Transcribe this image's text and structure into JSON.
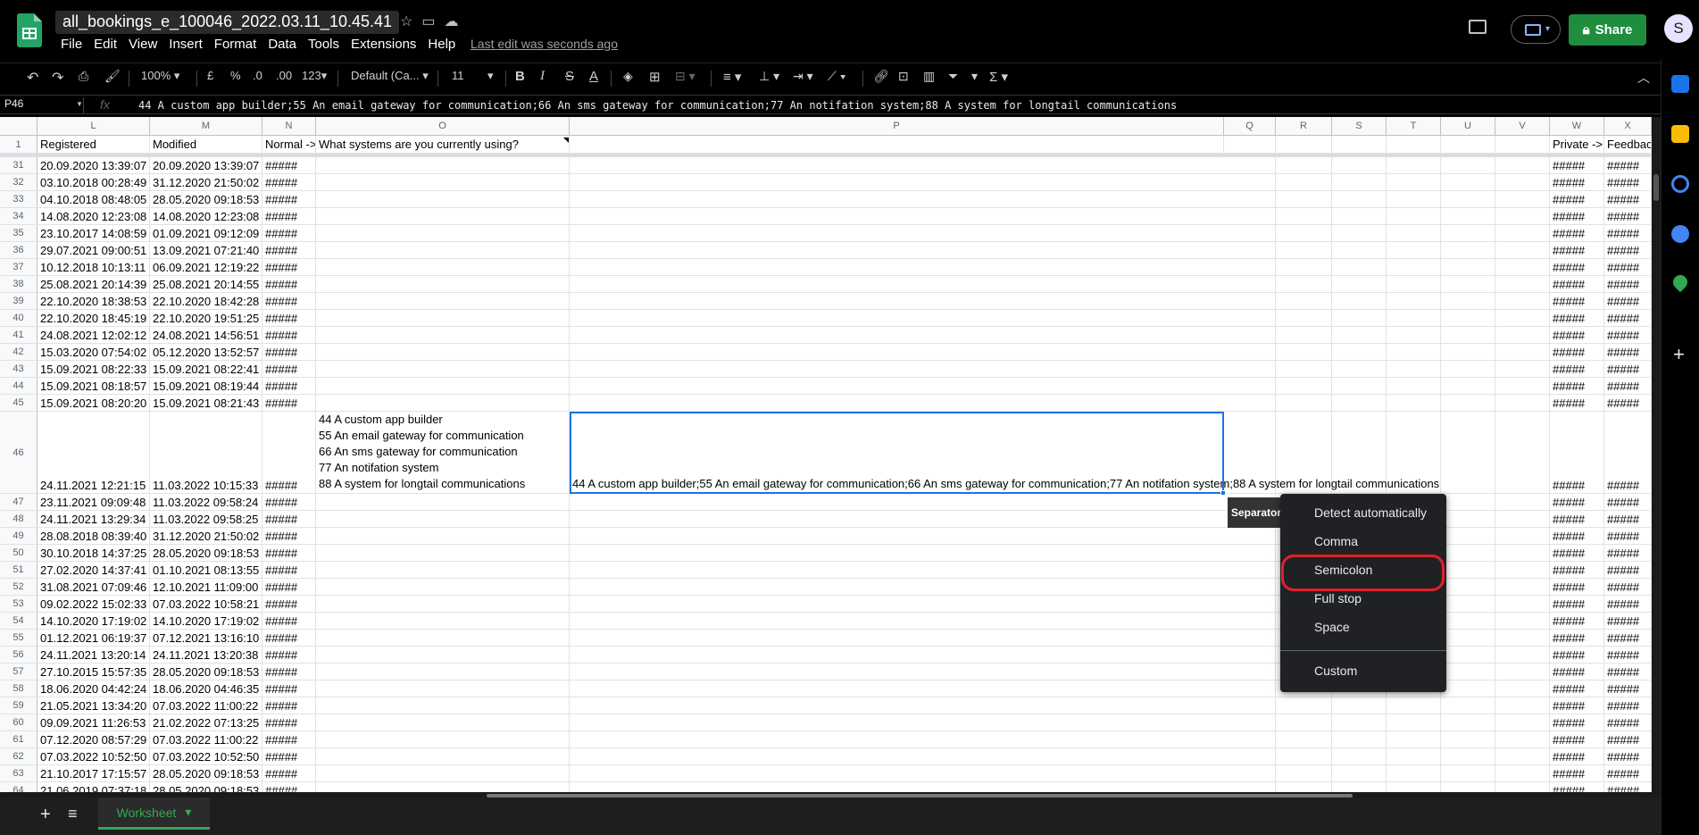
{
  "app": {
    "doc_title": "all_bookings_e_100046_2022.03.11_10.45.41",
    "menus": [
      "File",
      "Edit",
      "View",
      "Insert",
      "Format",
      "Data",
      "Tools",
      "Extensions",
      "Help"
    ],
    "last_edit": "Last edit was seconds ago",
    "share_label": "Share",
    "avatar_letter": "S"
  },
  "toolbar": {
    "zoom": "100%",
    "currency": "£",
    "percent": "%",
    "dec_decrease": ".0",
    "dec_increase": ".00",
    "more_formats": "123",
    "font": "Default (Ca...",
    "font_size": "11",
    "bold": "B",
    "italic": "I",
    "strike": "S",
    "text_color": "A",
    "sum": "Σ"
  },
  "formula_bar": {
    "cell_ref": "P46",
    "fx": "fx",
    "content": "44 A custom app builder;55 An email gateway for communication;66 An sms gateway for communication;77 An notifation system;88 A system for longtail communications"
  },
  "columns": [
    "L",
    "M",
    "N",
    "O",
    "P",
    "Q",
    "R",
    "S",
    "T",
    "U",
    "V",
    "W",
    "X"
  ],
  "header_row": {
    "num": "1",
    "cells": [
      "Registered",
      "Modified",
      "Normal ->",
      "What systems are you currently using?",
      "",
      "",
      "",
      "",
      "",
      "",
      "",
      "Private ->",
      "Feedback"
    ]
  },
  "rows": [
    {
      "num": "31",
      "l": "20.09.2020 13:39:07",
      "m": "20.09.2020 13:39:07",
      "n": "#####",
      "w": "#####",
      "x": "#####"
    },
    {
      "num": "32",
      "l": "03.10.2018 00:28:49",
      "m": "31.12.2020 21:50:02",
      "n": "#####",
      "w": "#####",
      "x": "#####"
    },
    {
      "num": "33",
      "l": "04.10.2018 08:48:05",
      "m": "28.05.2020 09:18:53",
      "n": "#####",
      "w": "#####",
      "x": "#####"
    },
    {
      "num": "34",
      "l": "14.08.2020 12:23:08",
      "m": "14.08.2020 12:23:08",
      "n": "#####",
      "w": "#####",
      "x": "#####"
    },
    {
      "num": "35",
      "l": "23.10.2017 14:08:59",
      "m": "01.09.2021 09:12:09",
      "n": "#####",
      "w": "#####",
      "x": "#####"
    },
    {
      "num": "36",
      "l": "29.07.2021 09:00:51",
      "m": "13.09.2021 07:21:40",
      "n": "#####",
      "w": "#####",
      "x": "#####"
    },
    {
      "num": "37",
      "l": "10.12.2018 10:13:11",
      "m": "06.09.2021 12:19:22",
      "n": "#####",
      "w": "#####",
      "x": "#####"
    },
    {
      "num": "38",
      "l": "25.08.2021 20:14:39",
      "m": "25.08.2021 20:14:55",
      "n": "#####",
      "w": "#####",
      "x": "#####"
    },
    {
      "num": "39",
      "l": "22.10.2020 18:38:53",
      "m": "22.10.2020 18:42:28",
      "n": "#####",
      "w": "#####",
      "x": "#####"
    },
    {
      "num": "40",
      "l": "22.10.2020 18:45:19",
      "m": "22.10.2020 19:51:25",
      "n": "#####",
      "w": "#####",
      "x": "#####"
    },
    {
      "num": "41",
      "l": "24.08.2021 12:02:12",
      "m": "24.08.2021 14:56:51",
      "n": "#####",
      "w": "#####",
      "x": "#####"
    },
    {
      "num": "42",
      "l": "15.03.2020 07:54:02",
      "m": "05.12.2020 13:52:57",
      "n": "#####",
      "w": "#####",
      "x": "#####"
    },
    {
      "num": "43",
      "l": "15.09.2021 08:22:33",
      "m": "15.09.2021 08:22:41",
      "n": "#####",
      "w": "#####",
      "x": "#####"
    },
    {
      "num": "44",
      "l": "15.09.2021 08:18:57",
      "m": "15.09.2021 08:19:44",
      "n": "#####",
      "w": "#####",
      "x": "#####"
    },
    {
      "num": "45",
      "l": "15.09.2021 08:20:20",
      "m": "15.09.2021 08:21:43",
      "n": "#####",
      "w": "#####",
      "x": "#####"
    },
    {
      "num": "46",
      "l": "24.11.2021 12:21:15",
      "m": "11.03.2022 10:15:33",
      "n": "#####",
      "w": "#####",
      "x": "#####",
      "o_lines": [
        "44 A custom app builder",
        "55 An email gateway for communication",
        "66 An sms gateway for communication",
        "77 An notifation system",
        "88 A system for longtail communications"
      ],
      "p": "44 A custom app builder;55 An email gateway for communication;66 An sms gateway for communication;77 An notifation system;88 A system for longtail communications"
    },
    {
      "num": "47",
      "l": "23.11.2021 09:09:48",
      "m": "11.03.2022 09:58:24",
      "n": "#####",
      "w": "#####",
      "x": "#####"
    },
    {
      "num": "48",
      "l": "24.11.2021 13:29:34",
      "m": "11.03.2022 09:58:25",
      "n": "#####",
      "w": "#####",
      "x": "#####"
    },
    {
      "num": "49",
      "l": "28.08.2018 08:39:40",
      "m": "31.12.2020 21:50:02",
      "n": "#####",
      "w": "#####",
      "x": "#####"
    },
    {
      "num": "50",
      "l": "30.10.2018 14:37:25",
      "m": "28.05.2020 09:18:53",
      "n": "#####",
      "w": "#####",
      "x": "#####"
    },
    {
      "num": "51",
      "l": "27.02.2020 14:37:41",
      "m": "01.10.2021 08:13:55",
      "n": "#####",
      "w": "#####",
      "x": "#####"
    },
    {
      "num": "52",
      "l": "31.08.2021 07:09:46",
      "m": "12.10.2021 11:09:00",
      "n": "#####",
      "w": "#####",
      "x": "#####"
    },
    {
      "num": "53",
      "l": "09.02.2022 15:02:33",
      "m": "07.03.2022 10:58:21",
      "n": "#####",
      "w": "#####",
      "x": "#####"
    },
    {
      "num": "54",
      "l": "14.10.2020 17:19:02",
      "m": "14.10.2020 17:19:02",
      "n": "#####",
      "w": "#####",
      "x": "#####"
    },
    {
      "num": "55",
      "l": "01.12.2021 06:19:37",
      "m": "07.12.2021 13:16:10",
      "n": "#####",
      "w": "#####",
      "x": "#####"
    },
    {
      "num": "56",
      "l": "24.11.2021 13:20:14",
      "m": "24.11.2021 13:20:38",
      "n": "#####",
      "w": "#####",
      "x": "#####"
    },
    {
      "num": "57",
      "l": "27.10.2015 15:57:35",
      "m": "28.05.2020 09:18:53",
      "n": "#####",
      "w": "#####",
      "x": "#####"
    },
    {
      "num": "58",
      "l": "18.06.2020 04:42:24",
      "m": "18.06.2020 04:46:35",
      "n": "#####",
      "w": "#####",
      "x": "#####"
    },
    {
      "num": "59",
      "l": "21.05.2021 13:34:20",
      "m": "07.03.2022 11:00:22",
      "n": "#####",
      "w": "#####",
      "x": "#####"
    },
    {
      "num": "60",
      "l": "09.09.2021 11:26:53",
      "m": "21.02.2022 07:13:25",
      "n": "#####",
      "w": "#####",
      "x": "#####"
    },
    {
      "num": "61",
      "l": "07.12.2020 08:57:29",
      "m": "07.03.2022 11:00:22",
      "n": "#####",
      "w": "#####",
      "x": "#####"
    },
    {
      "num": "62",
      "l": "07.03.2022 10:52:50",
      "m": "07.03.2022 10:52:50",
      "n": "#####",
      "w": "#####",
      "x": "#####"
    },
    {
      "num": "63",
      "l": "21.10.2017 17:15:57",
      "m": "28.05.2020 09:18:53",
      "n": "#####",
      "w": "#####",
      "x": "#####"
    },
    {
      "num": "64",
      "l": "21.06.2019 07:37:18",
      "m": "28.05.2020 09:18:53",
      "n": "#####",
      "w": "#####",
      "x": "#####"
    }
  ],
  "separator_popup": {
    "label": "Separator:",
    "options": [
      "Detect automatically",
      "Comma",
      "Semicolon",
      "Full stop",
      "Space",
      "Custom"
    ],
    "highlighted": "Semicolon"
  },
  "bottom": {
    "sheet_tab": "Worksheet"
  }
}
